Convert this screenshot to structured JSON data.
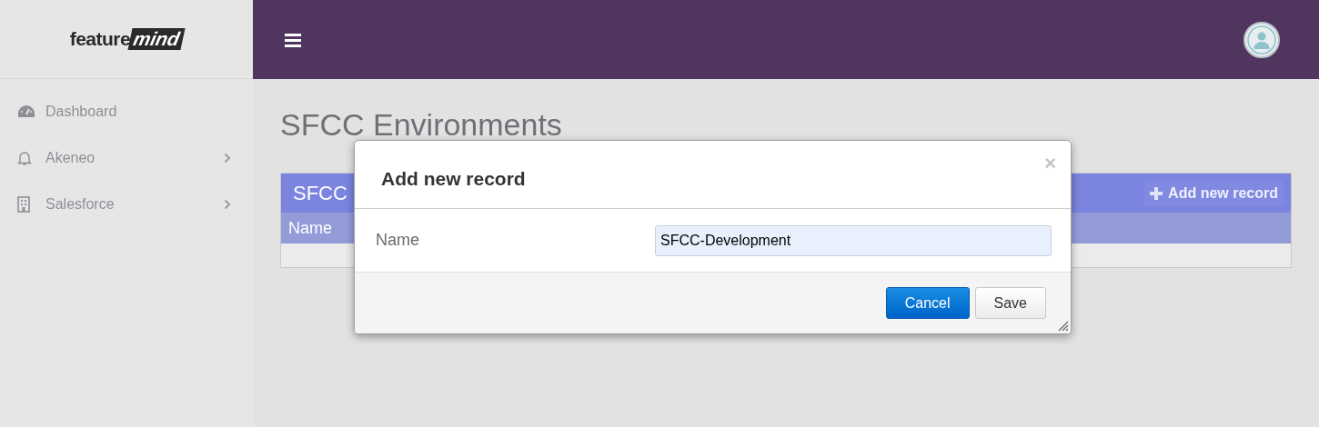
{
  "logo": {
    "part_1": "feature",
    "part_2": "mind"
  },
  "sidebar": {
    "items": [
      {
        "label": "Dashboard",
        "kind": "link"
      },
      {
        "label": "Akeneo",
        "kind": "submenu"
      },
      {
        "label": "Salesforce",
        "kind": "submenu"
      }
    ]
  },
  "page": {
    "title": "SFCC Environments",
    "panel": {
      "title": "SFCC",
      "add_button": "Add new record",
      "columns": [
        "Name"
      ]
    }
  },
  "modal": {
    "title": "Add new record",
    "close": "×",
    "fields": [
      {
        "label": "Name",
        "value": "SFCC-Development"
      }
    ],
    "buttons": [
      {
        "label": "Cancel",
        "kind": "primary"
      },
      {
        "label": "Save",
        "kind": "default"
      }
    ]
  }
}
